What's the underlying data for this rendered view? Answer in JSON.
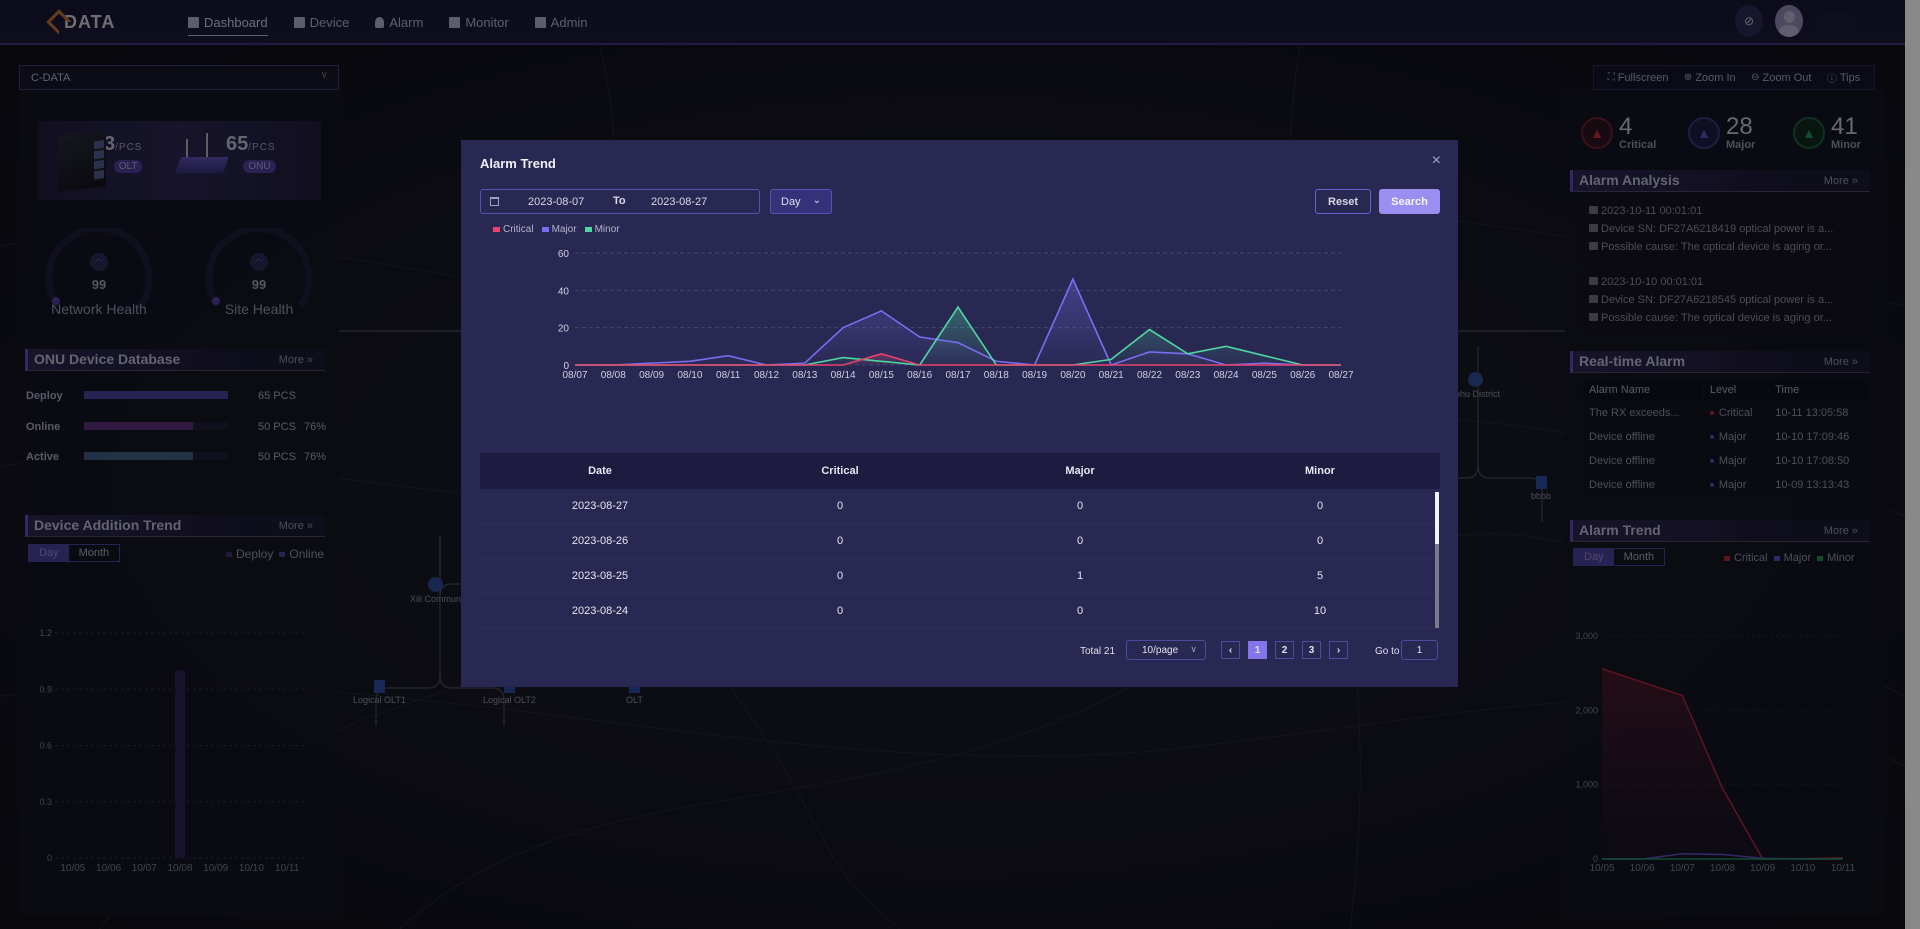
{
  "app": {
    "logo_text": "DATA"
  },
  "nav": [
    {
      "label": "Dashboard",
      "icon": "dashboard-icon",
      "active": true
    },
    {
      "label": "Device",
      "icon": "device-icon"
    },
    {
      "label": "Alarm",
      "icon": "bell-icon"
    },
    {
      "label": "Monitor",
      "icon": "monitor-icon"
    },
    {
      "label": "Admin",
      "icon": "admin-icon"
    }
  ],
  "org_select": {
    "value": "C-DATA"
  },
  "devices": {
    "olt": {
      "count": "3",
      "unit": "/PCS",
      "tag": "OLT"
    },
    "onu": {
      "count": "65",
      "unit": "/PCS",
      "tag": "ONU"
    }
  },
  "health": {
    "network": {
      "value": "99",
      "label": "Network Health"
    },
    "site": {
      "value": "99",
      "label": "Site Health"
    }
  },
  "onu_db": {
    "title": "ONU Device Database",
    "more": "More",
    "rows": [
      {
        "label": "Deploy",
        "count": "65 PCS",
        "pct": "",
        "fill": 1.0,
        "color": "#4a3f98"
      },
      {
        "label": "Online",
        "count": "50 PCS",
        "pct": "76%",
        "fill": 0.76,
        "color": "#5a2f78"
      },
      {
        "label": "Active",
        "count": "50 PCS",
        "pct": "76%",
        "fill": 0.76,
        "color": "#3e5a80"
      }
    ]
  },
  "device_trend": {
    "title": "Device Addition Trend",
    "more": "More",
    "tabs": [
      "Day",
      "Month"
    ],
    "legend": [
      "Deploy",
      "Online"
    ]
  },
  "map_tools": [
    "Fullscreen",
    "Zoom In",
    "Zoom Out",
    "Tips"
  ],
  "topology": {
    "nodes": [
      "Xili Commun",
      "Logical OLT1",
      "Logical OLT2",
      "OLT",
      "uohu District",
      "bbbb"
    ]
  },
  "alarm_counts": [
    {
      "label": "Critical",
      "value": "4",
      "color": "#c0283c"
    },
    {
      "label": "Major",
      "value": "28",
      "color": "#5b4cc0"
    },
    {
      "label": "Minor",
      "value": "41",
      "color": "#1e8a5a"
    }
  ],
  "alarm_analysis": {
    "title": "Alarm Analysis",
    "more": "More",
    "items": [
      {
        "time": "2023-10-11 00:01:01",
        "desc": "Device SN: DF27A6218419 optical power is a...",
        "cause": "Possible cause: The optical device is aging or..."
      },
      {
        "time": "2023-10-10 00:01:01",
        "desc": "Device SN: DF27A6218545 optical power is a...",
        "cause": "Possible cause: The optical device is aging or..."
      }
    ]
  },
  "realtime_alarm": {
    "title": "Real-time Alarm",
    "more": "More",
    "columns": [
      "Alarm Name",
      "Level",
      "Time"
    ],
    "rows": [
      {
        "name": "The RX exceeds...",
        "level": "Critical",
        "time": "10-11 13:05:58",
        "color": "#c0283c"
      },
      {
        "name": "Device offline",
        "level": "Major",
        "time": "10-10 17:09:46",
        "color": "#5b4cc0"
      },
      {
        "name": "Device offline",
        "level": "Major",
        "time": "10-10 17:08:50",
        "color": "#5b4cc0"
      },
      {
        "name": "Device offline",
        "level": "Major",
        "time": "10-09 13:13:43",
        "color": "#5b4cc0"
      }
    ]
  },
  "right_trend": {
    "title": "Alarm Trend",
    "more": "More",
    "tabs": [
      "Day",
      "Month"
    ],
    "legend": [
      "Critical",
      "Major",
      "Minor"
    ]
  },
  "modal": {
    "title": "Alarm Trend",
    "close": "×",
    "date_from": "2023-08-07",
    "to_label": "To",
    "date_to": "2023-08-27",
    "granularity": "Day",
    "reset": "Reset",
    "search": "Search",
    "legend": [
      "Critical",
      "Major",
      "Minor"
    ],
    "table": {
      "columns": [
        "Date",
        "Critical",
        "Major",
        "Minor"
      ],
      "rows": [
        [
          "2023-08-27",
          "0",
          "0",
          "0"
        ],
        [
          "2023-08-26",
          "0",
          "0",
          "0"
        ],
        [
          "2023-08-25",
          "0",
          "1",
          "5"
        ],
        [
          "2023-08-24",
          "0",
          "0",
          "10"
        ]
      ]
    },
    "pager": {
      "total": "Total 21",
      "page_size": "10/page",
      "pages": [
        "1",
        "2",
        "3"
      ],
      "current": "1",
      "goto_label": "Go to",
      "goto_value": "1"
    }
  },
  "chart_data": [
    {
      "id": "modal-alarm-trend",
      "type": "area",
      "title": "Alarm Trend",
      "x": [
        "08/07",
        "08/08",
        "08/09",
        "08/10",
        "08/11",
        "08/12",
        "08/13",
        "08/14",
        "08/15",
        "08/16",
        "08/17",
        "08/18",
        "08/19",
        "08/20",
        "08/21",
        "08/22",
        "08/23",
        "08/24",
        "08/25",
        "08/26",
        "08/27"
      ],
      "ylim": [
        0,
        60
      ],
      "yticks": [
        0,
        20,
        40,
        60
      ],
      "grid": true,
      "legend": "top-left",
      "series": [
        {
          "name": "Critical",
          "color": "#e8436a",
          "values": [
            0,
            0,
            0,
            0,
            0,
            0,
            0,
            0,
            6,
            0,
            0,
            0,
            0,
            0,
            0,
            0,
            0,
            0,
            0,
            0,
            0
          ]
        },
        {
          "name": "Major",
          "color": "#7b6cf0",
          "values": [
            0,
            0,
            1,
            2,
            5,
            0,
            1,
            20,
            29,
            15,
            12,
            2,
            0,
            46,
            0,
            7,
            6,
            0,
            1,
            0,
            0
          ]
        },
        {
          "name": "Minor",
          "color": "#4fd6a0",
          "values": [
            0,
            0,
            0,
            0,
            0,
            0,
            0,
            4,
            2,
            0,
            31,
            0,
            0,
            0,
            3,
            19,
            6,
            10,
            5,
            0,
            0
          ]
        }
      ]
    },
    {
      "id": "device-addition-trend",
      "type": "bar",
      "categories": [
        "10/05",
        "10/06",
        "10/07",
        "10/08",
        "10/09",
        "10/10",
        "10/11"
      ],
      "ylim": [
        0,
        1.2
      ],
      "yticks": [
        "0",
        "0.3",
        "0.6",
        "0.9",
        "1.2"
      ],
      "series": [
        {
          "name": "Deploy",
          "color": "#3a2f70",
          "values": [
            0,
            0,
            0,
            1,
            0,
            0,
            0
          ]
        },
        {
          "name": "Online",
          "color": "#4a3f98",
          "values": [
            0,
            0,
            0,
            0,
            0,
            0,
            0
          ]
        }
      ]
    },
    {
      "id": "right-alarm-trend",
      "type": "area",
      "x": [
        "10/05",
        "10/06",
        "10/07",
        "10/08",
        "10/09",
        "10/10",
        "10/11"
      ],
      "ylim": [
        0,
        3000
      ],
      "yticks": [
        "0",
        "1,000",
        "2,000",
        "3,000"
      ],
      "series": [
        {
          "name": "Critical",
          "color": "#a8283c",
          "values": [
            2560,
            2380,
            2200,
            950,
            0,
            5,
            15
          ]
        },
        {
          "name": "Major",
          "color": "#5b4cc0",
          "values": [
            0,
            0,
            70,
            60,
            10,
            0,
            0
          ]
        },
        {
          "name": "Minor",
          "color": "#1e8a5a",
          "values": [
            0,
            0,
            0,
            0,
            0,
            0,
            0
          ]
        }
      ]
    }
  ]
}
